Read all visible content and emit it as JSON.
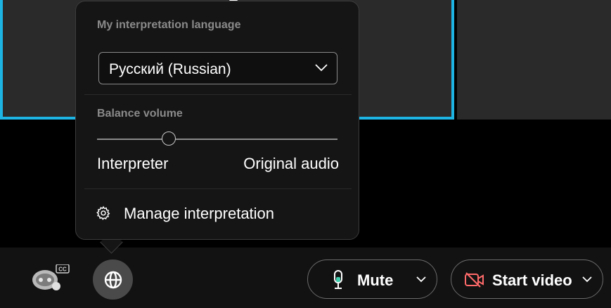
{
  "popover": {
    "language_label": "My interpretation language",
    "language_value": "Русский (Russian)",
    "balance_label": "Balance volume",
    "balance_level": 0.3,
    "left_end_label": "Interpreter",
    "right_end_label": "Original audio",
    "manage_label": "Manage interpretation"
  },
  "toolbar": {
    "cc_badge": "CC",
    "mute_label": "Mute",
    "start_video_label": "Start video"
  },
  "colors": {
    "accent_border": "#1db4e4",
    "mic_level": "#3fd0b0",
    "video_off": "#ff6a6a"
  },
  "icons": {
    "globe_button": "globe-icon",
    "cc_bot": "cc-bot-icon",
    "mic": "microphone-icon",
    "video": "video-off-icon",
    "settings": "gear-icon",
    "chevron": "chevron-down-icon"
  }
}
